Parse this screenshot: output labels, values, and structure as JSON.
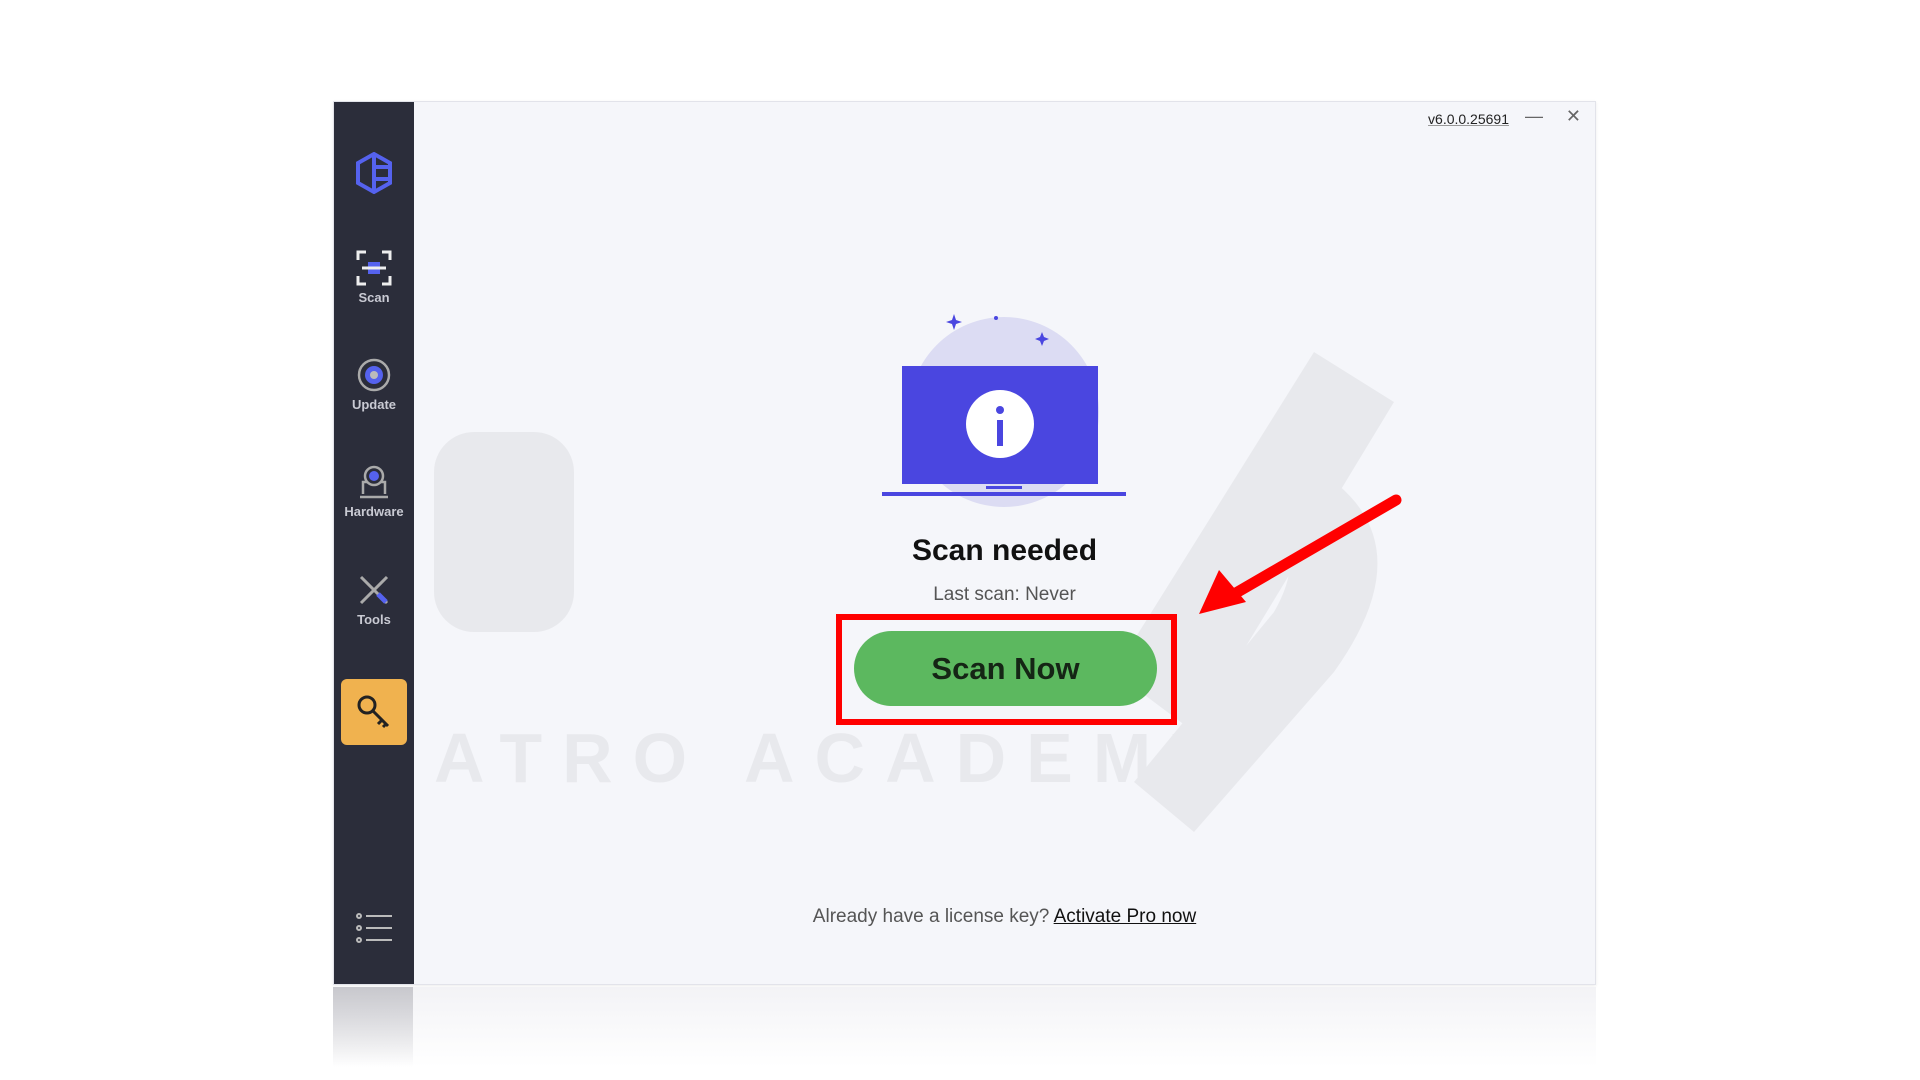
{
  "window": {
    "version": "v6.0.0.25691",
    "minimize": "—",
    "close": "✕"
  },
  "sidebar": {
    "items": [
      {
        "label": "Scan",
        "icon": "scan-icon"
      },
      {
        "label": "Update",
        "icon": "update-icon"
      },
      {
        "label": "Hardware",
        "icon": "hardware-icon"
      },
      {
        "label": "Tools",
        "icon": "tools-icon"
      }
    ],
    "key_icon": "key-icon",
    "menu_icon": "list-icon",
    "logo": "hexagon-logo"
  },
  "main": {
    "title": "Scan needed",
    "last_scan": "Last scan: Never",
    "scan_button": "Scan Now",
    "footer_text": "Already have a license key?",
    "footer_link": "Activate Pro now"
  },
  "watermark": "ATRO ACADEMY",
  "colors": {
    "sidebar": "#2b2d3a",
    "accent": "#4a46e0",
    "button": "#5cb85f",
    "key": "#f0b24f",
    "highlight": "#ff0000"
  }
}
